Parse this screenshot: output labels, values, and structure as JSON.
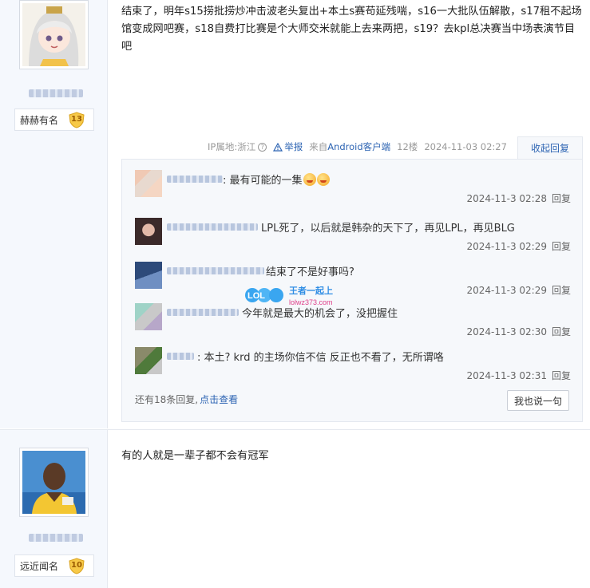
{
  "post1": {
    "user_badge": "赫赫有名",
    "user_level": "13",
    "content": "结束了，明年s15捞批捞炒冲击波老头复出+本土s赛苟延残喘，s16一大批队伍解散，s17租不起场馆变成网吧赛，s18自费打比赛是个大师交米就能上去来两把，s19？去kpl总决赛当中场表演节目吧",
    "meta": {
      "ip": "IP属地:浙江",
      "report": "举报",
      "source_prefix": "来自",
      "source": "Android客户端",
      "floor": "12楼",
      "time": "2024-11-03 02:27",
      "collapse": "收起回复"
    },
    "replies": [
      {
        "text": ": 最有可能的一集",
        "time": "2024-11-3 02:28",
        "reply": "回复",
        "emoji": true
      },
      {
        "text": "LPL死了，以后就是韩杂的天下了，再见LPL，再见BLG",
        "time": "2024-11-3 02:29",
        "reply": "回复"
      },
      {
        "text": "结束了不是好事吗?",
        "time": "2024-11-3 02:29",
        "reply": "回复"
      },
      {
        "text": "今年就是最大的机会了，没把握住",
        "time": "2024-11-3 02:30",
        "reply": "回复"
      },
      {
        "text": ": 本土? krd 的主场你信不信 反正也不看了，无所谓咯",
        "time": "2024-11-3 02:31",
        "reply": "回复"
      }
    ],
    "more_text": "还有18条回复,",
    "more_link": "点击查看",
    "say_button": "我也说一句"
  },
  "post2": {
    "user_badge": "远近闻名",
    "user_level": "10",
    "content": "有的人就是一辈子都不会有冠军"
  },
  "watermark": {
    "lol": "LOL",
    "brand": "王者一起上",
    "url": "lolwz373.com"
  },
  "colors": {
    "link_blue": "#2d64b3",
    "sidebar_bg": "#f5f8fd",
    "reply_bg": "#f6f8fb",
    "level_badge": "#f7c948"
  }
}
